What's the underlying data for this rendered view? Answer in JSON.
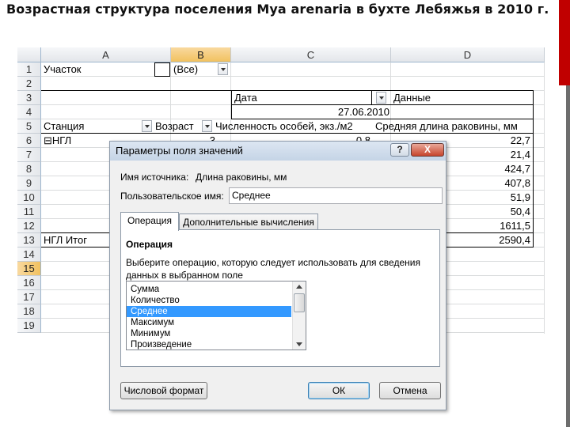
{
  "slide": {
    "title": "Возрастная структура поселения Mya arenaria в бухте Лебяжья в 2010 г."
  },
  "sheet": {
    "columns": [
      "A",
      "B",
      "C",
      "D"
    ],
    "rows": [
      "1",
      "2",
      "3",
      "4",
      "5",
      "6",
      "7",
      "8",
      "9",
      "10",
      "11",
      "12",
      "13",
      "14",
      "15",
      "16",
      "17",
      "18",
      "19"
    ],
    "selected_column": "B",
    "selected_row": "15",
    "cells": {
      "a1": "Участок",
      "b1": "(Все)",
      "c3": "Дата",
      "d3": "Данные",
      "c4": "27.06.2010",
      "a5": "Станция",
      "b5": "Возраст",
      "c5": "Численность особей, экз./м2",
      "d5": "Средняя длина раковины, мм",
      "a6": "⊟НГЛ",
      "b6": "3",
      "c6": "0,8",
      "a13": "НГЛ Итог"
    },
    "d_values": [
      "22,7",
      "21,4",
      "424,7",
      "407,8",
      "51,9",
      "50,4",
      "1611,5",
      "2590,4"
    ]
  },
  "dialog": {
    "title": "Параметры поля значений",
    "help": "?",
    "close": "X",
    "source_label": "Имя источника:",
    "source_value": "Длина раковины, мм",
    "custom_name_label": "Пользовательское имя:",
    "custom_name_value": "Среднее",
    "tabs": [
      "Операция",
      "Дополнительные вычисления"
    ],
    "section_title": "Операция",
    "description_line1": "Выберите операцию, которую следует использовать для сведения",
    "description_line2": "данных в выбранном поле",
    "operations": [
      "Сумма",
      "Количество",
      "Среднее",
      "Максимум",
      "Минимум",
      "Произведение"
    ],
    "selected_operation": "Среднее",
    "number_format_button": "Числовой формат",
    "ok_button": "ОК",
    "cancel_button": "Отмена"
  }
}
